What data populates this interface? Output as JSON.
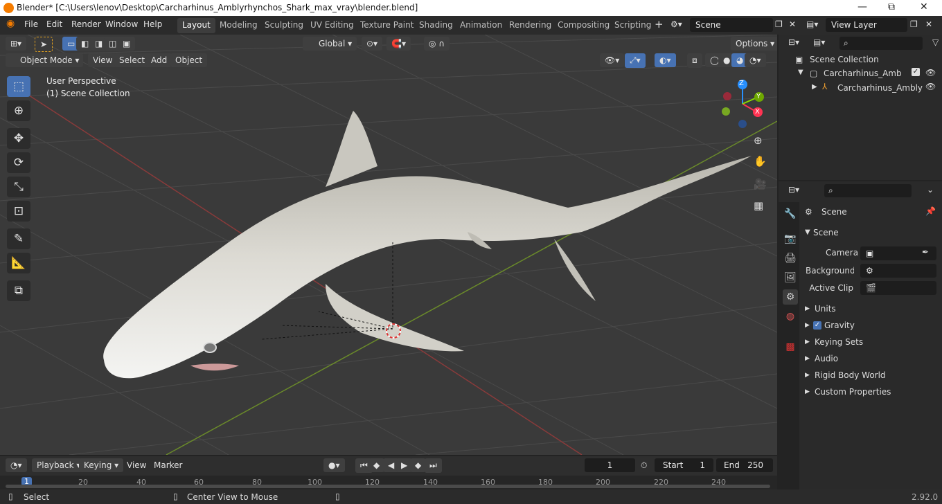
{
  "window": {
    "title": "Blender* [C:\\Users\\lenov\\Desktop\\Carcharhinus_Amblyrhynchos_Shark_max_vray\\blender.blend]",
    "minimize": "—",
    "maximize": "⧉",
    "close": "✕"
  },
  "menu": [
    "File",
    "Edit",
    "Render",
    "Window",
    "Help"
  ],
  "workspaces": [
    "Layout",
    "Modeling",
    "Sculpting",
    "UV Editing",
    "Texture Paint",
    "Shading",
    "Animation",
    "Rendering",
    "Compositing",
    "Scripting"
  ],
  "active_workspace": "Layout",
  "scene_field": "Scene",
  "view_layer_field": "View Layer",
  "viewport": {
    "mode": "Object Mode",
    "menus": [
      "View",
      "Select",
      "Add",
      "Object"
    ],
    "transform_orientation": "Global",
    "options": "Options",
    "overlay_line1": "User Perspective",
    "overlay_line2": "(1) Scene Collection",
    "gizmo": {
      "x": "X",
      "y": "Y",
      "z": "Z"
    }
  },
  "outliner": {
    "root": "Scene Collection",
    "collection": "Carcharhinus_Amblyrhyr",
    "object": "Carcharhinus_Ambly"
  },
  "properties": {
    "context": "Scene",
    "panel": "Scene",
    "camera_label": "Camera",
    "background_label": "Background ...",
    "active_clip_label": "Active Clip",
    "sections": [
      "Units",
      "Gravity",
      "Keying Sets",
      "Audio",
      "Rigid Body World",
      "Custom Properties"
    ],
    "gravity_checked": true
  },
  "timeline": {
    "menus": [
      "Playback",
      "Keying",
      "View",
      "Marker"
    ],
    "current_frame": "1",
    "start_label": "Start",
    "start_value": "1",
    "end_label": "End",
    "end_value": "250",
    "ruler": [
      "1",
      "20",
      "40",
      "60",
      "80",
      "100",
      "120",
      "140",
      "160",
      "180",
      "200",
      "220",
      "240"
    ]
  },
  "status": {
    "left": "Select",
    "middle": "Center View to Mouse",
    "version": "2.92.0"
  },
  "colors": {
    "accent": "#4772b3",
    "active_tab": "#3d3d3d",
    "x_axis": "#ff3352",
    "y_axis": "#8bdc00",
    "z_axis": "#2890ff"
  }
}
